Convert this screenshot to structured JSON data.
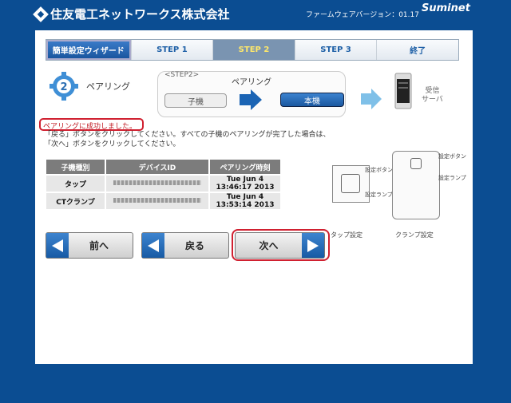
{
  "header": {
    "company": "住友電工ネットワークス株式会社",
    "firmware": "ファームウェアバージョン：01.17",
    "brand": "Suminet"
  },
  "tabs": [
    {
      "label": "簡単設定ウィザード"
    },
    {
      "label": "STEP 1"
    },
    {
      "label": "STEP 2"
    },
    {
      "label": "STEP 3"
    },
    {
      "label": "終了"
    }
  ],
  "step": {
    "number": "2",
    "title": "ペアリング"
  },
  "flow": {
    "step_label": "<STEP2>",
    "title": "ペアリング",
    "child": "子機",
    "main": "本機",
    "receiver": "受信\nサーバ"
  },
  "success": "ペアリングに成功しました。",
  "instruction": "「戻る」ボタンをクリックしてください。すべての子機のペアリングが完了した場合は、「次へ」ボタンをクリックしてください。",
  "table": {
    "headers": [
      "子機種別",
      "デバイスID",
      "ペアリング時刻"
    ],
    "rows": [
      {
        "type": "タップ",
        "time": "Tue Jun 4 13:46:17 2013"
      },
      {
        "type": "CTクランプ",
        "time": "Tue Jun 4 13:53:14 2013"
      }
    ]
  },
  "devices": {
    "tap_label": "タップ設定",
    "clamp_label": "クランプ設定",
    "setting_button": "設定ボタン",
    "setting_lamp": "設定ランプ"
  },
  "buttons": {
    "prev": "前へ",
    "back": "戻る",
    "next": "次へ"
  },
  "colors": {
    "background": "#0b4d92",
    "accent": "#1d5fa6",
    "highlight": "#d02030"
  }
}
